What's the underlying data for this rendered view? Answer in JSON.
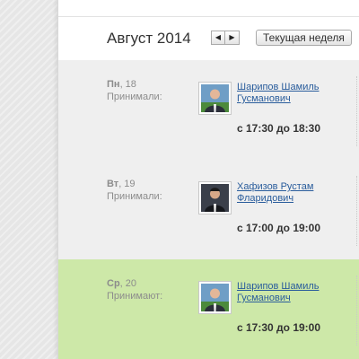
{
  "header": {
    "month_title": "Август 2014",
    "prev_icon": "◀",
    "next_icon": "▶",
    "current_week_label": "Текущая неделя"
  },
  "colors": {
    "row_gray": "#efefef",
    "row_highlight": "#cde8a8"
  },
  "days": [
    {
      "weekday": "Пн",
      "date": ", 18",
      "status": "Принимали:",
      "person_line1": "Шарипов Шамиль",
      "person_line2": "Гусманович",
      "time": "с 17:30 до 18:30"
    },
    {
      "weekday": "Вт",
      "date": ", 19",
      "status": "Принимали:",
      "person_line1": "Хафизов Рустам",
      "person_line2": "Фларидович",
      "time": "с 17:00 до 19:00"
    },
    {
      "weekday": "Ср",
      "date": ", 20",
      "status": "Принимают:",
      "person_line1": "Шарипов Шамиль",
      "person_line2": "Гусманович",
      "time": "с 17:30 до 19:00"
    }
  ]
}
